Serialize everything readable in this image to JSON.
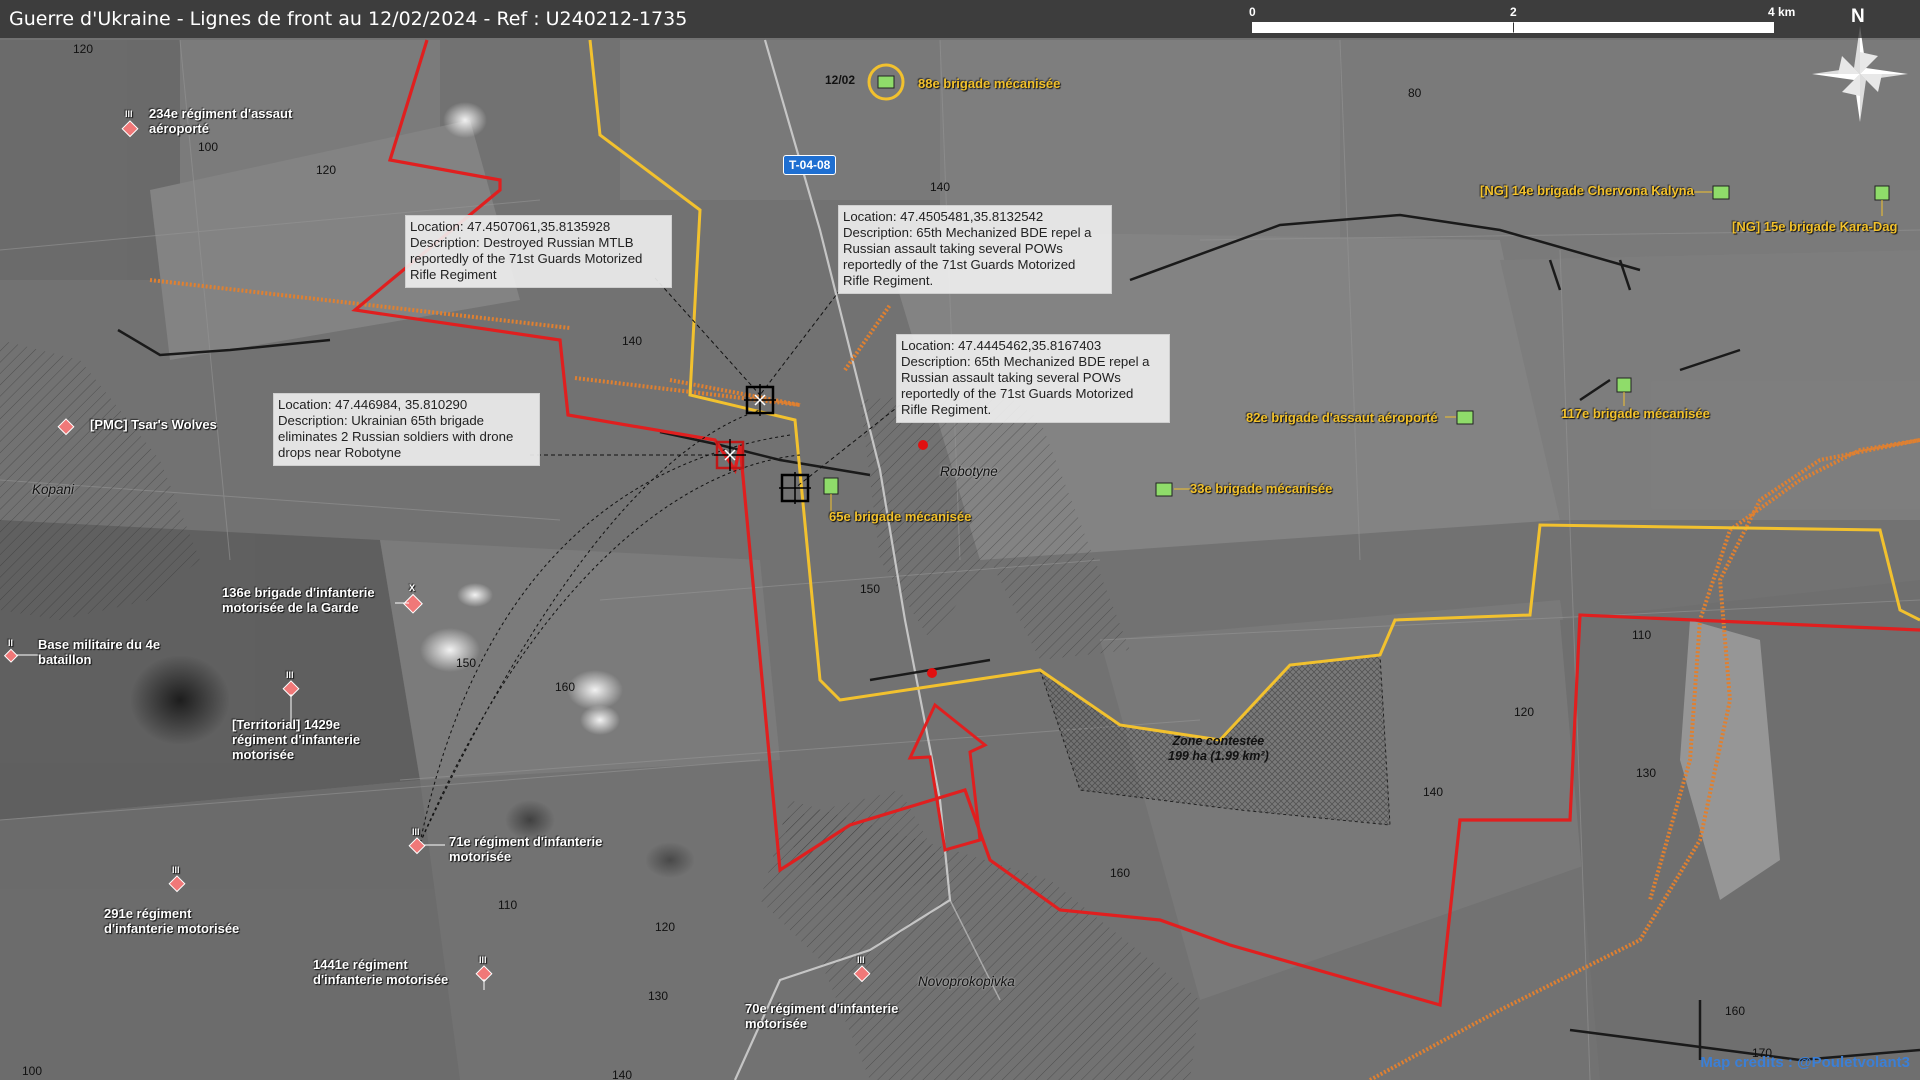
{
  "title": "Guerre d'Ukraine - Lignes de front au 12/02/2024 - Ref : U240212-1735",
  "scale_bar": {
    "ticks": [
      "0",
      "2",
      "4 km"
    ]
  },
  "compass_label": "N",
  "road_label": "T-04-08",
  "credits": "Map credits : @Pouletvolant3",
  "callouts": [
    {
      "lines": [
        "Location: 47.4507061,35.8135928",
        "Description: Destroyed Russian MTLB",
        "reportedly of the 71st Guards Motorized",
        "Rifle Regiment"
      ]
    },
    {
      "lines": [
        "Location: 47.4505481,35.8132542",
        "Description: 65th Mechanized BDE repel a",
        "Russian assault taking several POWs",
        "reportedly of the 71st Guards Motorized",
        "Rifle Regiment."
      ]
    },
    {
      "lines": [
        "Location: 47.4445462,35.8167403",
        "Description: 65th Mechanized BDE repel a",
        "Russian assault taking several POWs",
        "reportedly of the 71st Guards Motorized",
        "Rifle Regiment."
      ]
    },
    {
      "lines": [
        "Location: 47.446984, 35.810290",
        "Description: Ukrainian 65th brigade",
        "eliminates 2 Russian soldiers with drone",
        "drops near Robotyne"
      ]
    }
  ],
  "units_ua": [
    {
      "name": "88e brigade mécanisée",
      "date": "12/02"
    },
    {
      "name": "65e brigade mécanisée"
    },
    {
      "name": "33e brigade mécanisée"
    },
    {
      "name": "82e brigade d'assaut aéroporté"
    },
    {
      "name": "117e brigade mécanisée"
    },
    {
      "name": "[NG] 14e brigade Chervona Kalyna"
    },
    {
      "name": "[NG] 15e brigade Kara-Dag"
    }
  ],
  "units_ru": [
    {
      "lines": [
        "234e régiment d'assaut",
        "aéroporté"
      ],
      "echelon": "III"
    },
    {
      "lines": [
        "[PMC] Tsar's Wolves"
      ],
      "echelon": ""
    },
    {
      "lines": [
        "136e brigade d'infanterie",
        "motorisée de la Garde"
      ],
      "echelon": "X"
    },
    {
      "lines": [
        "Base militaire du 4e",
        "bataillon"
      ],
      "echelon": "II"
    },
    {
      "lines": [
        "[Territorial] 1429e",
        "régiment d'infanterie",
        "motorisée"
      ],
      "echelon": "III"
    },
    {
      "lines": [
        "71e régiment d'infanterie",
        "motorisée"
      ],
      "echelon": "III"
    },
    {
      "lines": [
        "291e régiment",
        "d'infanterie motorisée"
      ],
      "echelon": "III"
    },
    {
      "lines": [
        "1441e régiment",
        "d'infanterie motorisée"
      ],
      "echelon": "III"
    },
    {
      "lines": [
        "70e régiment d'infanterie",
        "motorisée"
      ],
      "echelon": "III"
    }
  ],
  "towns": [
    "Robotyne",
    "Kopani",
    "Novoprokopivka"
  ],
  "contested_zone": {
    "name": "Zone contestée",
    "area": "199 ha (1.99 km²)"
  },
  "elevations": [
    "120",
    "100",
    "120",
    "80",
    "140",
    "140",
    "150",
    "150",
    "160",
    "110",
    "120",
    "110",
    "120",
    "130",
    "140",
    "160",
    "130",
    "100",
    "140",
    "160",
    "170"
  ],
  "colors": {
    "russian_line": "#e01f1f",
    "ukrainian_line": "#f2c12e",
    "fortification": "#e08030",
    "ua_unit": "#8fdc6a",
    "ru_unit": "#f07878",
    "strike_marker": "#e01010"
  }
}
